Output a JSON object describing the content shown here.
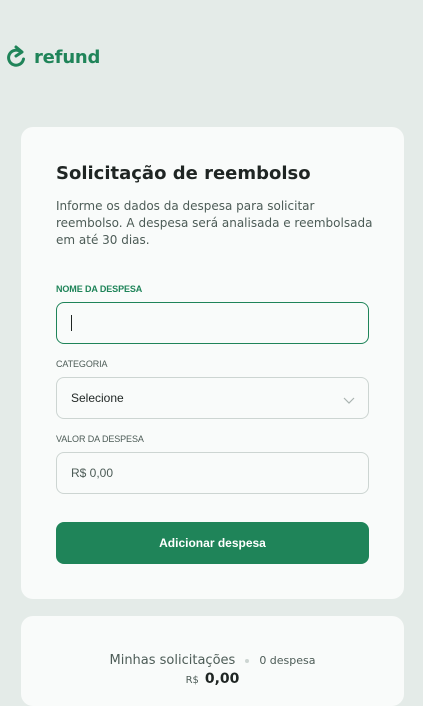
{
  "brand": {
    "name": "refund",
    "color": "#1f8459"
  },
  "form": {
    "title": "Solicitação de reembolso",
    "description": "Informe os dados da despesa para solicitar reembolso. A despesa será analisada e reembolsada em até 30 dias.",
    "fields": {
      "name": {
        "label": "NOME DA DESPESA",
        "value": ""
      },
      "category": {
        "label": "CATEGORIA",
        "value": "Selecione"
      },
      "amount": {
        "label": "VALOR DA DESPESA",
        "placeholder": "R$ 0,00"
      }
    },
    "submit_label": "Adicionar despesa"
  },
  "summary": {
    "title": "Minhas solicitações",
    "count_text": "0 despesa",
    "currency": "R$",
    "total": "0,00"
  }
}
